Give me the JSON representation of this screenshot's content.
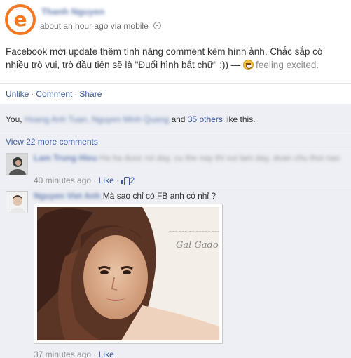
{
  "post": {
    "author": "Thanh Nguyen",
    "meta": "about an hour ago via mobile",
    "status_text": "Facebook mới update thêm tính năng comment kèm hình ảnh. Chắc sắp có nhiều trò vui, trò đầu tiên sẽ là \"Đuổi hình bắt chữ\" :)) — ",
    "mood": "feeling excited."
  },
  "actions": {
    "unlike": "Unlike",
    "comment": "Comment",
    "share": "Share",
    "sep": "·"
  },
  "likes": {
    "prefix": "You,",
    "blurred_names": "Hoang Anh Tuan, Nguyen Minh Quang",
    "and": "and",
    "others_link": "35 others",
    "suffix": "like this."
  },
  "view_more": "View 22 more comments",
  "comments": [
    {
      "author": "Lam Trung Hieu",
      "text": "Ha ha duoc roi day, cu the nay thi vui lam day, doan chu thoi nao",
      "time": "40 minutes ago",
      "sep": "·",
      "like": "Like",
      "like_count": "2"
    },
    {
      "author": "Nguyen Viet Anh",
      "text": "Mà sao chỉ có FB anh có nhỉ ?",
      "time": "37 minutes ago",
      "sep": "·",
      "like": "Like",
      "photo_caption": "Gal Gadot"
    }
  ],
  "colors": {
    "link": "#3b5998",
    "brand_orange": "#f47920",
    "feedback_bg": "#edeff4"
  }
}
